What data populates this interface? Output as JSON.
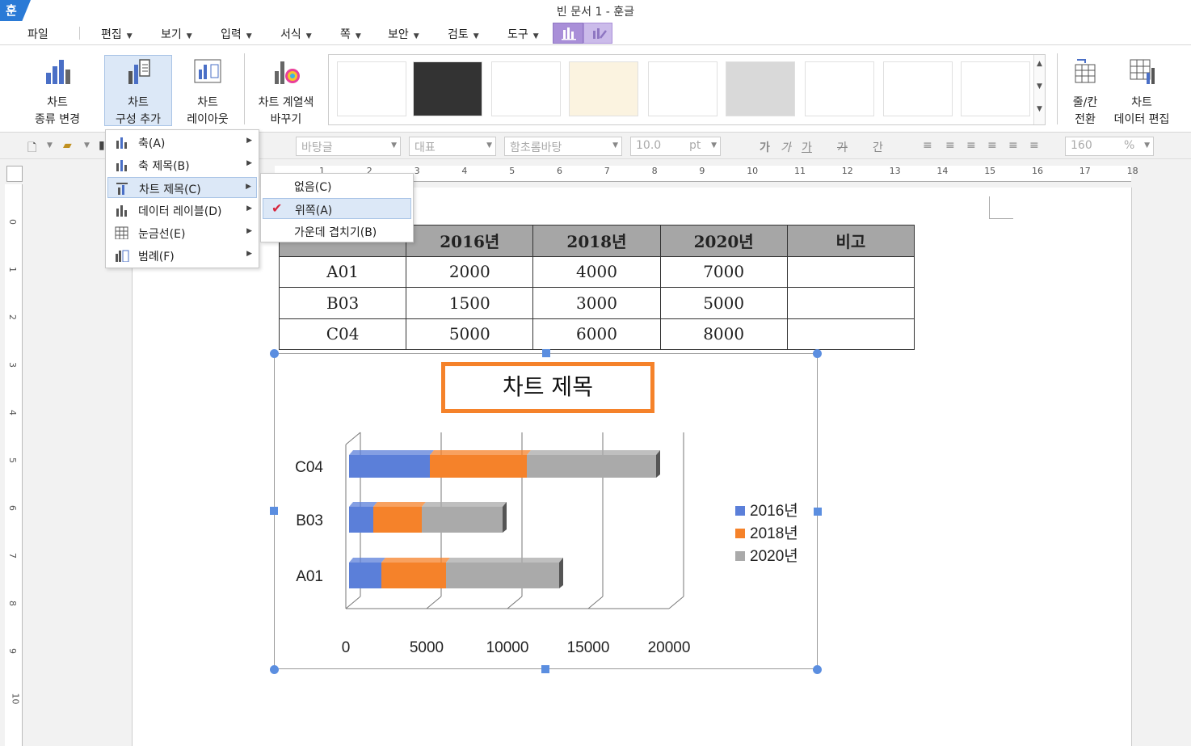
{
  "app": {
    "logo": "훈",
    "title": "빈 문서 1 - 훈글"
  },
  "menubar": {
    "items": [
      "파일",
      "편집",
      "보기",
      "입력",
      "서식",
      "쪽",
      "보안",
      "검토",
      "도구"
    ]
  },
  "ribbon": {
    "change_type": "차트\n종류 변경",
    "add_element": "차트\n구성 추가",
    "layout": "차트\n레이아웃",
    "color": "차트 계열색\n바꾸기",
    "switch_rowcol": "줄/칸\n전환",
    "edit_data": "차트\n데이터 편집"
  },
  "toolbar": {
    "style": "바탕글",
    "outline": "대표",
    "font": "함초롬바탕",
    "size": "10.0",
    "unit": "pt",
    "zoom": "160",
    "zoom_unit": "%"
  },
  "context_menu": {
    "items": [
      "축(A)",
      "축 제목(B)",
      "차트 제목(C)",
      "데이터 레이블(D)",
      "눈금선(E)",
      "범례(F)"
    ],
    "highlighted": "차트 제목(C)"
  },
  "submenu": {
    "items": [
      "없음(C)",
      "위쪽(A)",
      "가운데 겹치기(B)"
    ],
    "checked": "위쪽(A)"
  },
  "table": {
    "headers": [
      "2016년",
      "2018년",
      "2020년",
      "비고"
    ],
    "rows": [
      [
        "A01",
        "2000",
        "4000",
        "7000",
        ""
      ],
      [
        "B03",
        "1500",
        "3000",
        "5000",
        ""
      ],
      [
        "C04",
        "5000",
        "6000",
        "8000",
        ""
      ]
    ]
  },
  "chart_data": {
    "type": "bar",
    "orientation": "horizontal",
    "stacked": true,
    "title": "차트 제목",
    "categories": [
      "A01",
      "B03",
      "C04"
    ],
    "series": [
      {
        "name": "2016년",
        "values": [
          2000,
          1500,
          5000
        ],
        "color": "#5b7fd9"
      },
      {
        "name": "2018년",
        "values": [
          4000,
          3000,
          6000
        ],
        "color": "#f5822a"
      },
      {
        "name": "2020년",
        "values": [
          7000,
          5000,
          8000
        ],
        "color": "#aaaaaa"
      }
    ],
    "xlim": [
      0,
      20000
    ],
    "xticks": [
      "0",
      "5000",
      "10000",
      "15000",
      "20000"
    ],
    "legend": "right",
    "grid": true
  },
  "ruler": {
    "h": [
      "1",
      "2",
      "3",
      "4",
      "5",
      "6",
      "7",
      "8",
      "9",
      "10",
      "11",
      "12",
      "13",
      "14",
      "15",
      "16",
      "17",
      "18"
    ],
    "v": [
      "0",
      "1",
      "2",
      "3",
      "4",
      "5",
      "6",
      "7",
      "8",
      "9",
      "10"
    ]
  }
}
